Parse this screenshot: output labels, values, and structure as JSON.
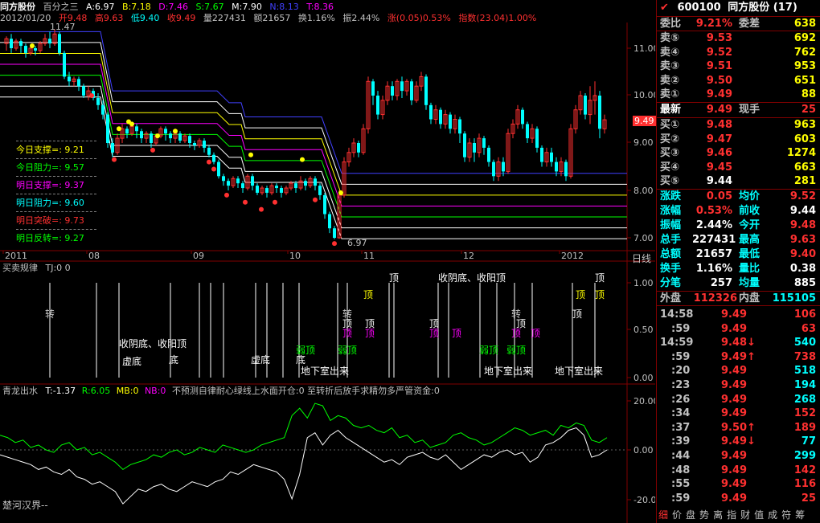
{
  "header": {
    "stock_name": "同方股份",
    "indicator": "百分之三",
    "a_label": "A:6.97",
    "b_label": "B:7.18",
    "d_label": "D:7.46",
    "s_label": "S:7.67",
    "m_label": "M:7.90",
    "n_label": "N:8.13",
    "t_label": "T:8.36",
    "date": "2012/01/20",
    "open": "开9.48",
    "high": "高9.63",
    "low": "低9.40",
    "close": "收9.49",
    "volume": "量227431",
    "amount": "额21657",
    "turnover": "换1.16%",
    "amplitude": "振2.44%",
    "change": "涨(0.05)0.53%",
    "index": "指数(23.04)1.00%"
  },
  "main_chart": {
    "max_label": "11.47",
    "min_label": "6.97",
    "price_tag": "9.49",
    "y_ticks": [
      "11.00",
      "10.00",
      "9.00",
      "8.00",
      "7.00"
    ],
    "x_ticks": [
      "2011",
      "08",
      "09",
      "10",
      "11",
      "12",
      "2012"
    ],
    "period": "日线",
    "info_box": [
      {
        "label": "今日支撑=: 9.21",
        "color": "#ffff00"
      },
      {
        "label": "今日阻力=: 9.57",
        "color": "#00ff00"
      },
      {
        "label": "明日支撑=: 9.37",
        "color": "#ff00ff"
      },
      {
        "label": "明日阻力=: 9.60",
        "color": "#00ffff"
      },
      {
        "label": "明日突破=: 9.73",
        "color": "#ff3030"
      },
      {
        "label": "明日反转=: 9.27",
        "color": "#00ff00"
      }
    ]
  },
  "sub1": {
    "title": "买卖规律",
    "tj": "TJ:0 0",
    "y_ticks": [
      "1.00",
      "0.50",
      "0.00"
    ],
    "labels": {
      "zhuan": "转",
      "ding": "顶",
      "ruoding": "弱顶",
      "shouyindi": "收阴底、收阳顶",
      "xudi": "虚底",
      "di": "底",
      "dixia": "地下室出来"
    }
  },
  "sub2": {
    "title": "青龙出水",
    "t_val": "T:-1.37",
    "r_val": "R:6.05",
    "mb_val": "MB:0",
    "nb_val": "NB:0",
    "rest": "不预测自律耐心绿线上水面开仓:0 至转折后放手求精勿多严管资金:0",
    "y_ticks": [
      "20.00",
      "0.00",
      "-20.00"
    ],
    "bottom_label": "楚河汉界--"
  },
  "panel": {
    "code": "600100",
    "name": "同方股份",
    "count": "(17)",
    "weibi_label": "委比",
    "weibi_val": "9.21%",
    "weicha_label": "委差",
    "weicha_val": "638",
    "asks": [
      {
        "label": "卖⑤",
        "price": "9.53",
        "vol": "692"
      },
      {
        "label": "卖④",
        "price": "9.52",
        "vol": "762"
      },
      {
        "label": "卖③",
        "price": "9.51",
        "vol": "953"
      },
      {
        "label": "卖②",
        "price": "9.50",
        "vol": "651"
      },
      {
        "label": "卖①",
        "price": "9.49",
        "vol": "88"
      }
    ],
    "latest_label": "最新",
    "latest_val": "9.49",
    "xianshou_label": "现手",
    "xianshou_val": "25",
    "bids": [
      {
        "label": "买①",
        "price": "9.48",
        "vol": "963"
      },
      {
        "label": "买②",
        "price": "9.47",
        "vol": "603"
      },
      {
        "label": "买③",
        "price": "9.46",
        "vol": "1274"
      },
      {
        "label": "买④",
        "price": "9.45",
        "vol": "663"
      },
      {
        "label": "买⑤",
        "price": "9.44",
        "vol": "281"
      }
    ],
    "stats": [
      {
        "l1": "涨跌",
        "v1": "0.05",
        "c1": "#ff3030",
        "l2": "均价",
        "v2": "9.52",
        "c2": "#ff3030"
      },
      {
        "l1": "涨幅",
        "v1": "0.53%",
        "c1": "#ff3030",
        "l2": "前收",
        "v2": "9.44",
        "c2": "#ffffff"
      },
      {
        "l1": "振幅",
        "v1": "2.44%",
        "c1": "#ffffff",
        "l2": "今开",
        "v2": "9.48",
        "c2": "#ff3030"
      },
      {
        "l1": "总手",
        "v1": "227431",
        "c1": "#ffffff",
        "l2": "最高",
        "v2": "9.63",
        "c2": "#ff3030"
      },
      {
        "l1": "总额",
        "v1": "21657",
        "c1": "#ffffff",
        "l2": "最低",
        "v2": "9.40",
        "c2": "#ff3030"
      },
      {
        "l1": "换手",
        "v1": "1.16%",
        "c1": "#ffffff",
        "l2": "量比",
        "v2": "0.38",
        "c2": "#ffffff"
      },
      {
        "l1": "分笔",
        "v1": "257",
        "c1": "#ffffff",
        "l2": "均量",
        "v2": "885",
        "c2": "#ffffff"
      }
    ],
    "waipan_label": "外盘",
    "waipan_val": "112326",
    "neipan_label": "内盘",
    "neipan_val": "115105",
    "ticks": [
      {
        "time": "14:58",
        "price": "9.49",
        "vol": "106",
        "arrow": "",
        "vc": "#ff3030"
      },
      {
        "time": ":59",
        "price": "9.49",
        "vol": "63",
        "arrow": "",
        "vc": "#ff3030"
      },
      {
        "time": "14:59",
        "price": "9.48↓",
        "vol": "540",
        "arrow": "",
        "vc": "#00ffff"
      },
      {
        "time": ":59",
        "price": "9.49↑",
        "vol": "738",
        "arrow": "",
        "vc": "#ff3030"
      },
      {
        "time": ":20",
        "price": "9.49",
        "vol": "518",
        "arrow": "",
        "vc": "#00ffff"
      },
      {
        "time": ":23",
        "price": "9.49",
        "vol": "194",
        "arrow": "",
        "vc": "#00ffff"
      },
      {
        "time": ":26",
        "price": "9.49",
        "vol": "268",
        "arrow": "",
        "vc": "#00ffff"
      },
      {
        "time": ":34",
        "price": "9.49",
        "vol": "152",
        "arrow": "",
        "vc": "#ff3030"
      },
      {
        "time": ":37",
        "price": "9.50↑",
        "vol": "189",
        "arrow": "",
        "vc": "#ff3030"
      },
      {
        "time": ":39",
        "price": "9.49↓",
        "vol": "77",
        "arrow": "",
        "vc": "#00ffff"
      },
      {
        "time": ":44",
        "price": "9.49",
        "vol": "299",
        "arrow": "",
        "vc": "#00ffff"
      },
      {
        "time": ":48",
        "price": "9.49",
        "vol": "142",
        "arrow": "",
        "vc": "#ff3030"
      },
      {
        "time": ":55",
        "price": "9.49",
        "vol": "116",
        "arrow": "",
        "vc": "#ff3030"
      },
      {
        "time": ":59",
        "price": "9.49",
        "vol": "25",
        "arrow": "",
        "vc": "#ff3030"
      }
    ],
    "bottom_tabs": [
      "细",
      "价",
      "盘",
      "势",
      "离",
      "指",
      "财",
      "值",
      "成",
      "符",
      "筹"
    ]
  },
  "colors": {
    "up": "#ff3030",
    "down": "#00ffff",
    "grid": "#800000",
    "text": "#c0c0c0"
  }
}
